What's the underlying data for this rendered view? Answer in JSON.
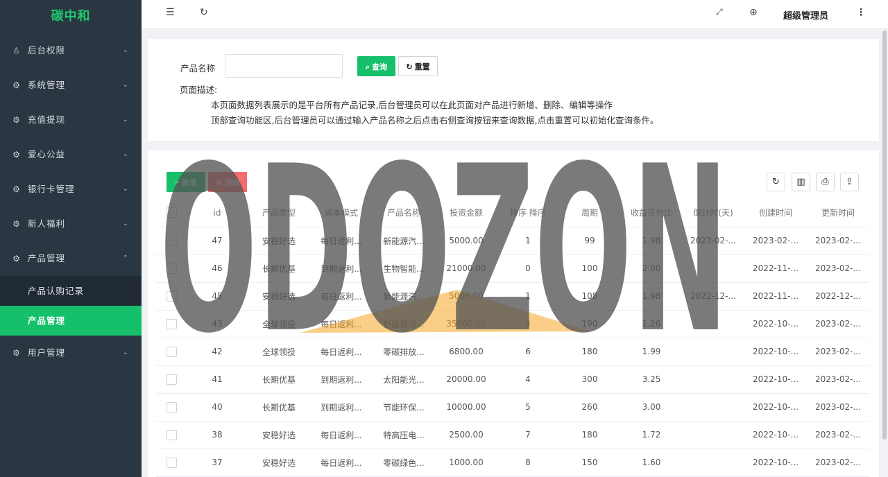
{
  "sidebar": {
    "logo": "碳中和",
    "menus": [
      {
        "label": "后台权限",
        "icon": "user-icon",
        "arrow": "⌄"
      },
      {
        "label": "系统管理",
        "icon": "gear-icon",
        "arrow": "⌄"
      },
      {
        "label": "充值提现",
        "icon": "gear-icon",
        "arrow": "⌄"
      },
      {
        "label": "爱心公益",
        "icon": "gear-icon",
        "arrow": "⌄"
      },
      {
        "label": "银行卡管理",
        "icon": "gear-icon",
        "arrow": "⌄"
      },
      {
        "label": "新人福利",
        "icon": "gear-icon",
        "arrow": "⌄"
      },
      {
        "label": "产品管理",
        "icon": "gear-icon",
        "arrow": "⌃"
      }
    ],
    "sub_items": [
      "产品认购记录",
      "产品管理"
    ],
    "last_menu": {
      "label": "用户管理",
      "icon": "gear-icon",
      "arrow": "⌄"
    }
  },
  "header": {
    "admin_name": "超级管理员"
  },
  "search": {
    "label": "产品名称",
    "placeholder": "",
    "search_btn": "查询",
    "reset_btn": "重置",
    "desc_title": "页面描述:",
    "desc_line1": "本页面数据列表展示的是平台所有产品记录,后台管理员可以在此页面对产品进行新增、删除、编辑等操作",
    "desc_line2": "顶部查询功能区,后台管理员可以通过输入产品名称之后点击右侧查询按钮来查询数据,点击重置可以初始化查询条件。"
  },
  "toolbar": {
    "add_btn": "新增",
    "delete_btn": "删除"
  },
  "table": {
    "headers": [
      "id",
      "产品类型",
      "返本模式",
      "产品名称",
      "投资金额",
      "排序 降序",
      "周期",
      "收益百分比",
      "倒计时(天)",
      "创建时间",
      "更新时间"
    ],
    "rows": [
      [
        "47",
        "安稳好选",
        "每日返利...",
        "新能源汽...",
        "5000.00",
        "1",
        "99",
        "1.98",
        "2023-02-...",
        "2023-02-...",
        "2023-02-..."
      ],
      [
        "46",
        "长期优基",
        "到期返利...",
        "生物智能...",
        "21000.00",
        "0",
        "100",
        "2.00",
        "",
        "2022-11-...",
        "2023-02-..."
      ],
      [
        "45",
        "安稳好选",
        "每日返利...",
        "新能源汽...",
        "5000.00",
        "1",
        "108",
        "1.98",
        "2022-12-...",
        "2022-11-...",
        "2022-12-..."
      ],
      [
        "43",
        "全球领投",
        "每日返利...",
        "新能源减...",
        "35000.00",
        "3",
        "190",
        "1.26",
        "",
        "2022-10-...",
        "2023-02-..."
      ],
      [
        "42",
        "全球领投",
        "每日返利...",
        "零碳排放...",
        "6800.00",
        "6",
        "180",
        "1.99",
        "",
        "2022-10-...",
        "2023-02-..."
      ],
      [
        "41",
        "长期优基",
        "到期返利...",
        "太阳能光...",
        "20000.00",
        "4",
        "300",
        "3.25",
        "",
        "2022-10-...",
        "2023-02-..."
      ],
      [
        "40",
        "长期优基",
        "到期返利...",
        "节能环保...",
        "10000.00",
        "5",
        "260",
        "3.00",
        "",
        "2022-10-...",
        "2023-02-..."
      ],
      [
        "38",
        "安稳好选",
        "每日返利...",
        "特高压电...",
        "2500.00",
        "7",
        "180",
        "1.72",
        "",
        "2022-10-...",
        "2023-02-..."
      ],
      [
        "37",
        "安稳好选",
        "每日返利...",
        "零碳绿色...",
        "1000.00",
        "8",
        "150",
        "1.60",
        "",
        "2022-10-...",
        "2023-02-..."
      ]
    ]
  },
  "watermark": {
    "text": "ODOZON"
  },
  "colors": {
    "primary": "#16c06a",
    "danger": "#f56c6c",
    "sidebar_bg": "#2b3643"
  }
}
